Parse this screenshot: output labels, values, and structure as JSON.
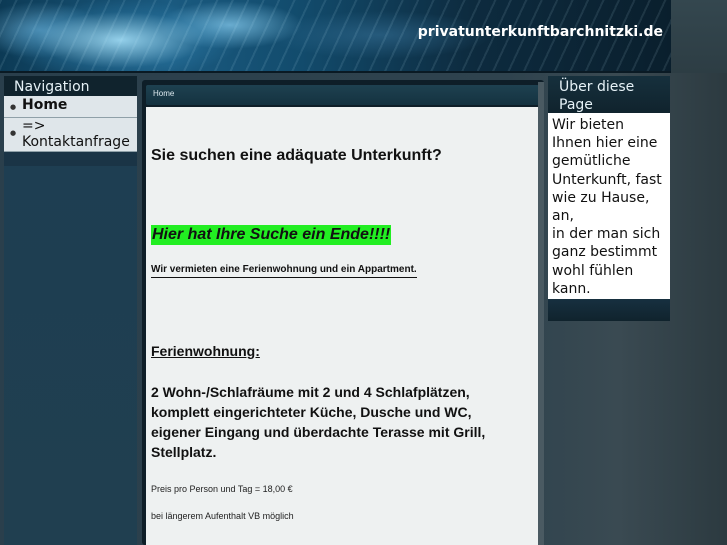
{
  "header": {
    "site_title": "privatunterkunftbarchnitzki.de"
  },
  "nav": {
    "title": "Navigation",
    "items": [
      {
        "label": "Home",
        "active": true
      },
      {
        "label": "=> Kontaktanfrage",
        "line1": "=>",
        "line2": "Kontaktanfrage",
        "active": false
      }
    ]
  },
  "breadcrumb": {
    "label": "Home"
  },
  "content": {
    "heading": "Sie suchen eine adäquate Unterkunft?",
    "highlight": "Hier hat Ihre Suche ein Ende!!!!",
    "subheading": "Wir vermieten eine Ferienwohnung und ein Appartment.",
    "section_title": "Ferienwohnung:",
    "description_lines": [
      "2 Wohn-/Schlafräume mit 2 und 4 Schlafplätzen,",
      "komplett eingerichteter Küche, Dusche und WC,",
      "eigener Eingang und überdachte Terasse mit Grill,",
      "Stellplatz."
    ],
    "price": "Preis pro Person und Tag = 18,00 €",
    "long_stay": "bei längerem Aufenthalt VB möglich"
  },
  "right_panel": {
    "title_line1": "Über diese",
    "title_line2": "Page",
    "text_lines": [
      "Wir bieten",
      "Ihnen hier eine",
      "gemütliche",
      "Unterkunft, fast",
      "wie zu Hause,",
      "an,",
      "in der man sich",
      "ganz bestimmt",
      "wohl fühlen",
      "kann."
    ]
  },
  "colors": {
    "highlight_bg": "#22ee22",
    "nav_bg": "#1d3e52",
    "content_bg": "#eef1f1"
  }
}
